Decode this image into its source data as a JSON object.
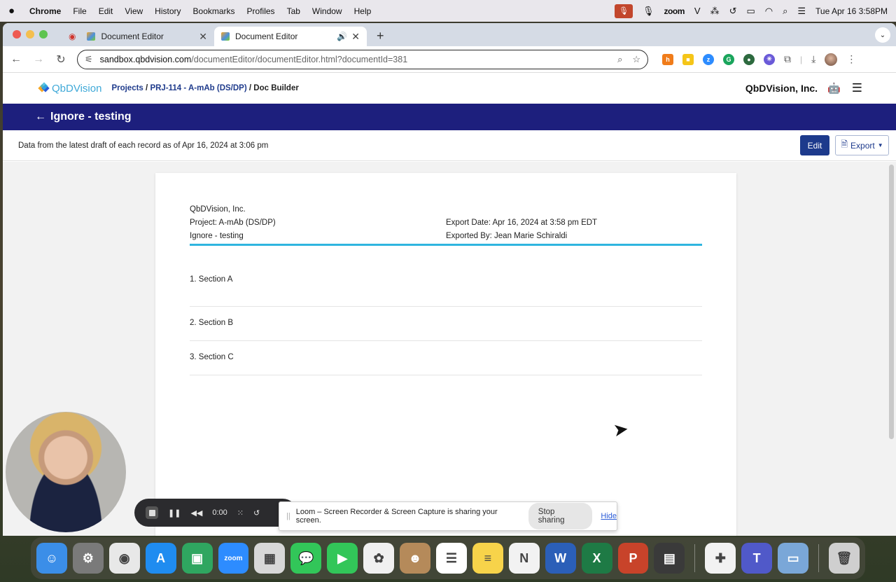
{
  "menubar": {
    "app": "Chrome",
    "items": [
      "File",
      "Edit",
      "View",
      "History",
      "Bookmarks",
      "Profiles",
      "Tab",
      "Window",
      "Help"
    ],
    "zoom": "zoom",
    "datetime": "Tue Apr 16  3:58PM"
  },
  "browser": {
    "tabs": [
      {
        "title": "Document Editor",
        "active": false
      },
      {
        "title": "Document Editor",
        "active": true
      }
    ],
    "url_host": "sandbox.qbdvision.com",
    "url_path": "/documentEditor/documentEditor.html?documentId=381"
  },
  "app": {
    "logo": "QbDVision",
    "breadcrumb": {
      "projects": "Projects",
      "project": "PRJ-114 - A-mAb (DS/DP)",
      "current": "Doc Builder",
      "sep": "/"
    },
    "company": "QbDVision, Inc.",
    "page_title": "Ignore - testing",
    "back_glyph": "←",
    "info_text": "Data from the latest draft of each record as of Apr 16, 2024 at 3:06 pm",
    "edit_label": "Edit",
    "export_label": "Export"
  },
  "document": {
    "company": "QbDVision, Inc.",
    "project": "Project: A-mAb (DS/DP)",
    "doc_name": "Ignore - testing",
    "export_date": "Export Date: Apr 16, 2024 at 3:58 pm EDT",
    "exported_by": "Exported By: Jean Marie Schiraldi",
    "sections": [
      "1. Section A",
      "2. Section B",
      "3. Section C"
    ]
  },
  "loom": {
    "timer": "0:00",
    "share_text": "Loom – Screen Recorder & Screen Capture is sharing your screen.",
    "stop_label": "Stop sharing",
    "hide_label": "Hide"
  },
  "dock": {
    "apps": [
      {
        "name": "finder",
        "color": "#3b8ee8",
        "glyph": "☺"
      },
      {
        "name": "system-settings",
        "color": "#7a7a7a",
        "glyph": "⚙"
      },
      {
        "name": "chrome",
        "color": "#e8e8e8",
        "glyph": "◉"
      },
      {
        "name": "app-store",
        "color": "#1f8cf0",
        "glyph": "A"
      },
      {
        "name": "google-meet",
        "color": "#2fa660",
        "glyph": "▣"
      },
      {
        "name": "zoom",
        "color": "#2d8cff",
        "glyph": "zoom"
      },
      {
        "name": "launchpad",
        "color": "#d8d8d8",
        "glyph": "▦"
      },
      {
        "name": "messages",
        "color": "#32c659",
        "glyph": "💬"
      },
      {
        "name": "facetime",
        "color": "#32c659",
        "glyph": "▶"
      },
      {
        "name": "photos",
        "color": "#f0f0f0",
        "glyph": "✿"
      },
      {
        "name": "contacts",
        "color": "#b58a5a",
        "glyph": "☻"
      },
      {
        "name": "reminders",
        "color": "#ffffff",
        "glyph": "☰"
      },
      {
        "name": "notes",
        "color": "#f7d34a",
        "glyph": "≡"
      },
      {
        "name": "news",
        "color": "#f2f2f2",
        "glyph": "N"
      },
      {
        "name": "word",
        "color": "#2b5fb8",
        "glyph": "W"
      },
      {
        "name": "excel",
        "color": "#1e7a45",
        "glyph": "X"
      },
      {
        "name": "powerpoint",
        "color": "#c8432a",
        "glyph": "P"
      },
      {
        "name": "calculator",
        "color": "#3a3a3a",
        "glyph": "▤"
      },
      {
        "name": "slack",
        "color": "#f2f2f2",
        "glyph": "✚"
      },
      {
        "name": "teams",
        "color": "#5059c9",
        "glyph": "T"
      },
      {
        "name": "preview",
        "color": "#7aa7d8",
        "glyph": "▭"
      },
      {
        "name": "trash",
        "color": "#cfcfcf",
        "glyph": "🗑"
      }
    ]
  }
}
